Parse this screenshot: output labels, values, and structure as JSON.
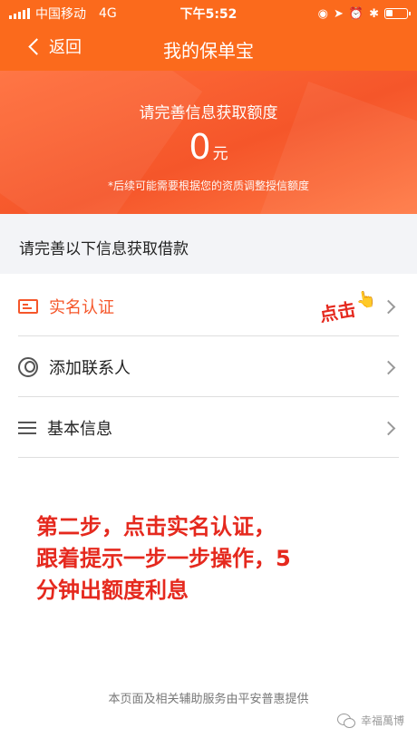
{
  "status_bar": {
    "carrier": "中国移动",
    "network": "4G",
    "time": "下午5:52"
  },
  "nav": {
    "back_label": "返回",
    "title": "我的保单宝"
  },
  "hero": {
    "subtitle": "请完善信息获取额度",
    "amount": "0",
    "unit": "元",
    "note": "*后续可能需要根据您的资质调整授信额度"
  },
  "section": {
    "header": "请完善以下信息获取借款"
  },
  "list": {
    "items": [
      {
        "label": "实名认证",
        "icon": "id-card-icon"
      },
      {
        "label": "添加联系人",
        "icon": "contact-icon"
      },
      {
        "label": "基本信息",
        "icon": "menu-icon"
      }
    ]
  },
  "annotation": {
    "click_label": "点击",
    "instruction_lines": [
      "第二步，点击实名认证，",
      "跟着提示一步一步操作，5",
      "分钟出额度利息"
    ]
  },
  "footer": {
    "note": "本页面及相关辅助服务由平安普惠提供",
    "watermark": "幸福萬博"
  },
  "colors": {
    "brand_orange": "#fb6a1c",
    "hero_red": "#f5562a",
    "annotation_red": "#e5291e"
  }
}
